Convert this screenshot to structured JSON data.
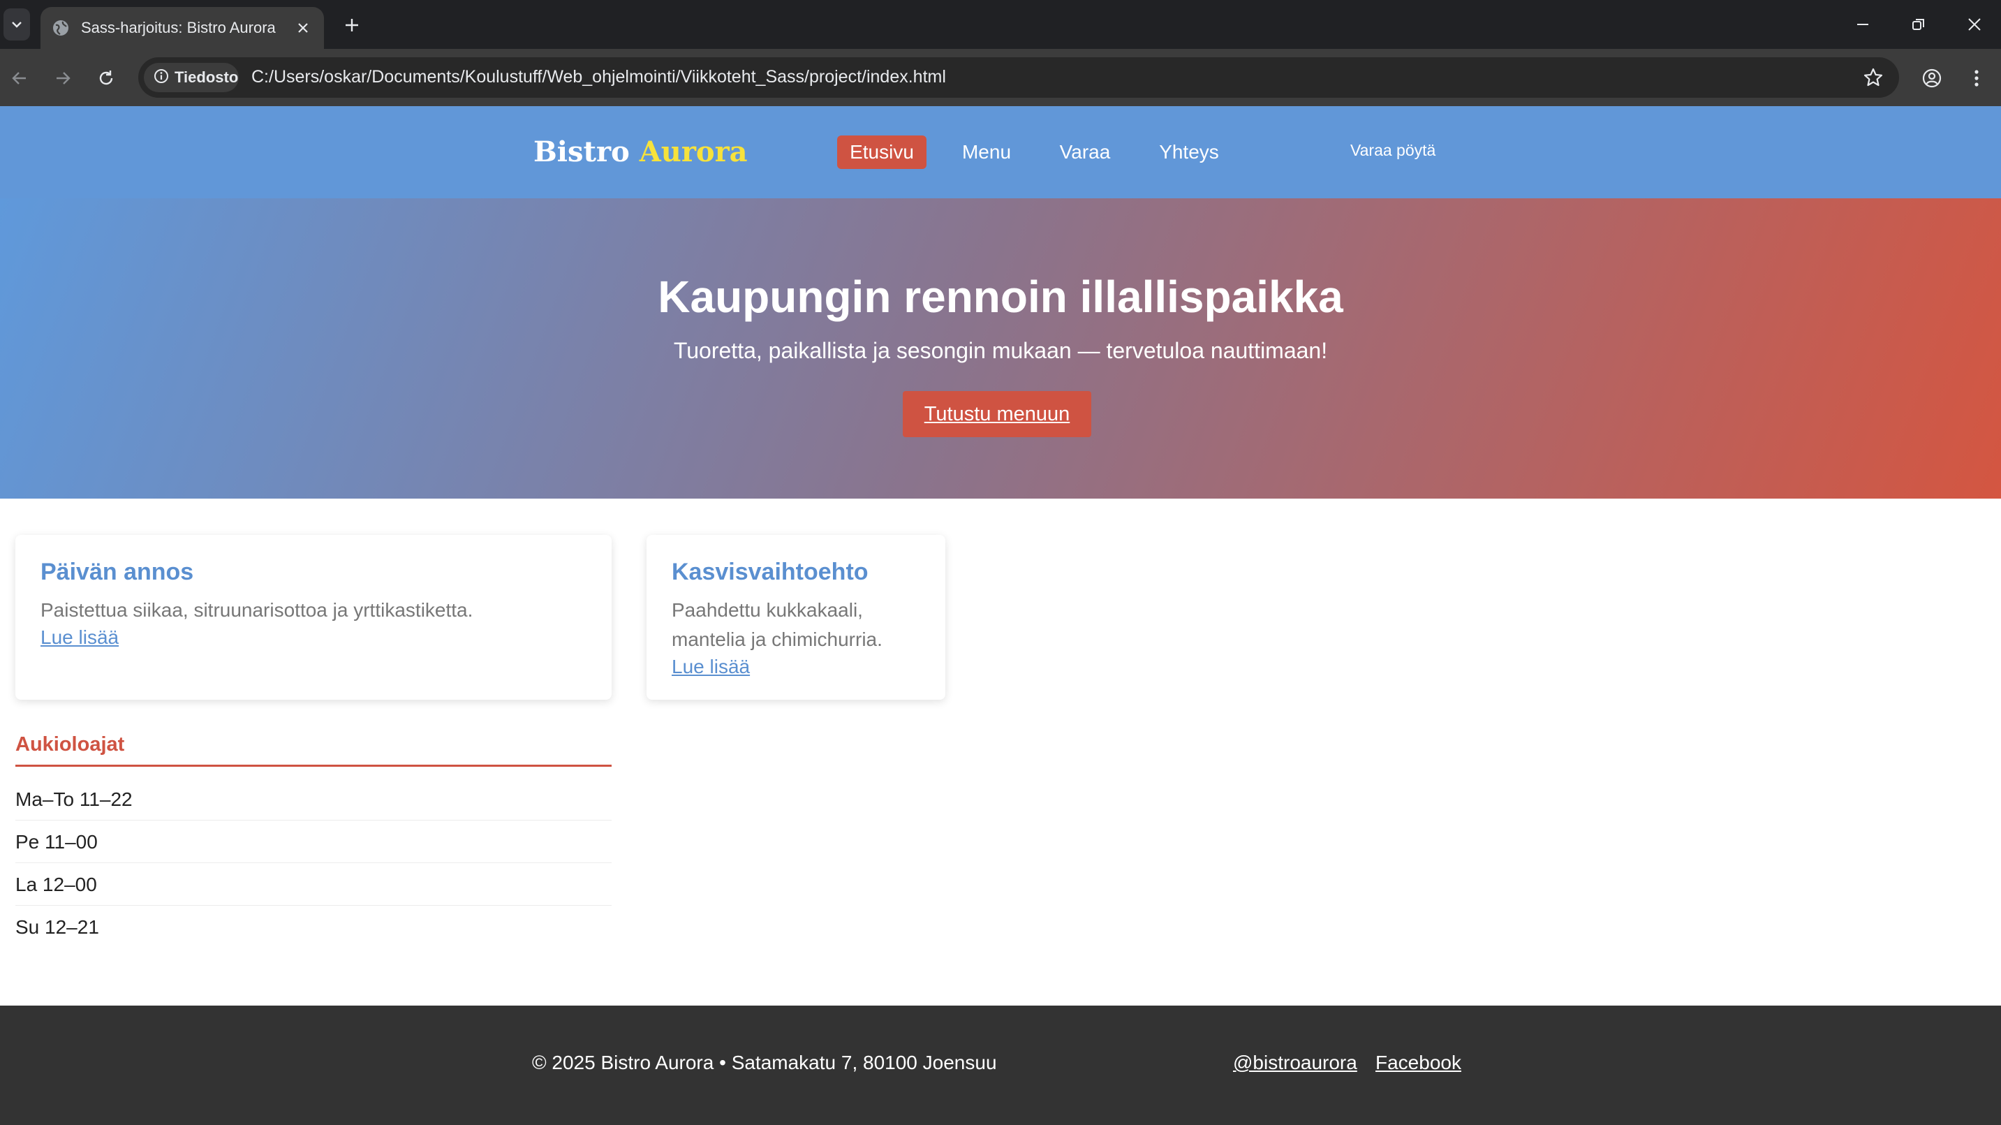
{
  "browser": {
    "tab_title": "Sass-harjoitus: Bistro Aurora",
    "site_chip": "Tiedosto",
    "url": "C:/Users/oskar/Documents/Koulustuff/Web_ohjelmointi/Viikkoteht_Sass/project/index.html",
    "icons": [
      "tab-search-icon",
      "globe-icon",
      "close-icon",
      "plus-icon",
      "minimize-icon",
      "restore-icon",
      "close-window-icon",
      "back-icon",
      "forward-icon",
      "reload-icon",
      "info-icon",
      "star-icon",
      "profile-icon",
      "more-vertical-icon"
    ]
  },
  "site": {
    "logo_main": "Bistro",
    "logo_accent": "Aurora",
    "nav": [
      "Etusivu",
      "Menu",
      "Varaa",
      "Yhteys"
    ],
    "active_nav": "Etusivu",
    "header_cta": "Varaa pöytä",
    "colors": {
      "header": "#6197d8",
      "accent": "#cf5342",
      "logo_accent": "#f7e23b",
      "footer": "#333333"
    }
  },
  "hero": {
    "title": "Kaupungin rennoin illallispaikka",
    "subtitle": "Tuoretta, paikallista ja sesongin mukaan — tervetuloa nauttimaan!",
    "button": "Tutustu menuun"
  },
  "cards": [
    {
      "title": "Päivän annos",
      "text": "Paistettua siikaa, sitruunarisottoa ja yrttikastiketta.",
      "link": "Lue lisää"
    },
    {
      "title": "Kasvisvaihtoehto",
      "text": "Paahdettu kukkakaali, mantelia ja chimichurria.",
      "link": "Lue lisää"
    }
  ],
  "hours": {
    "title": "Aukioloajat",
    "items": [
      "Ma–To 11–22",
      "Pe 11–00",
      "La 12–00",
      "Su 12–21"
    ]
  },
  "footer": {
    "text": "© 2025 Bistro Aurora • Satamakatu 7, 80100 Joensuu",
    "links": [
      "@bistroaurora",
      "Facebook"
    ]
  }
}
